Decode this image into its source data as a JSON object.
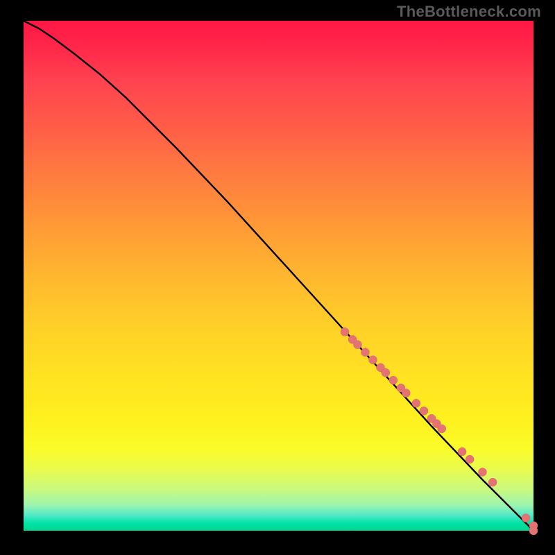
{
  "watermark": "TheBottleneck.com",
  "colors": {
    "page_bg": "#000000",
    "curve": "#000000",
    "marker_fill": "#e57373",
    "marker_stroke": "#d26b6b",
    "watermark": "#5a5a5a",
    "gradient_top": "#ff1744",
    "gradient_mid": "#ffe322",
    "gradient_bottom": "#00d38e"
  },
  "chart_data": {
    "type": "line",
    "title": "",
    "xlabel": "",
    "ylabel": "",
    "xlim": [
      0,
      100
    ],
    "ylim": [
      0,
      100
    ],
    "curve": {
      "x": [
        0,
        3,
        6,
        10,
        15,
        20,
        30,
        40,
        50,
        60,
        70,
        80,
        90,
        100
      ],
      "y": [
        100,
        98.5,
        96.5,
        93.5,
        89.5,
        85,
        75,
        64.5,
        53.5,
        42.5,
        31.5,
        20.5,
        10,
        0
      ]
    },
    "series": [
      {
        "name": "points",
        "x": [
          63,
          64.5,
          65.5,
          67,
          68.5,
          70,
          71,
          72.5,
          74,
          75,
          77,
          78.5,
          80,
          81,
          82,
          86,
          87.5,
          90,
          92,
          98.5,
          100,
          100
        ],
        "y": [
          39,
          37.5,
          36.5,
          35,
          33.5,
          32,
          31,
          29.5,
          28,
          27,
          25,
          23.5,
          22,
          21,
          20,
          15.5,
          14,
          11.5,
          9.5,
          2.5,
          1,
          0
        ],
        "marker_radius": 6
      }
    ]
  }
}
